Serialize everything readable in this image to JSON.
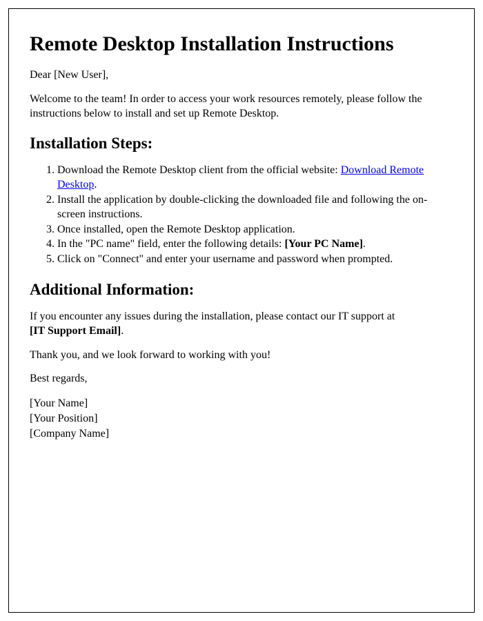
{
  "title": "Remote Desktop Installation Instructions",
  "greeting_prefix": "Dear ",
  "greeting_name": "[New User]",
  "greeting_suffix": ",",
  "intro": "Welcome to the team! In order to access your work resources remotely, please follow the instructions below to install and set up Remote Desktop.",
  "steps_heading": "Installation Steps:",
  "steps": {
    "s1_pre": "Download the Remote Desktop client from the official website: ",
    "s1_link": "Download Remote Desktop",
    "s1_post": ".",
    "s2": "Install the application by double-clicking the downloaded file and following the on-screen instructions.",
    "s3": "Once installed, open the Remote Desktop application.",
    "s4_pre": "In the \"PC name\" field, enter the following details: ",
    "s4_bold": "[Your PC Name]",
    "s4_post": ".",
    "s5": "Click on \"Connect\" and enter your username and password when prompted."
  },
  "additional_heading": "Additional Information:",
  "support_pre": "If you encounter any issues during the installation, please contact our IT support at ",
  "support_bold": "[IT Support Email]",
  "support_post": ".",
  "thanks": "Thank you, and we look forward to working with you!",
  "regards": "Best regards,",
  "sig_name": "[Your Name]",
  "sig_position": "[Your Position]",
  "sig_company": "[Company Name]"
}
